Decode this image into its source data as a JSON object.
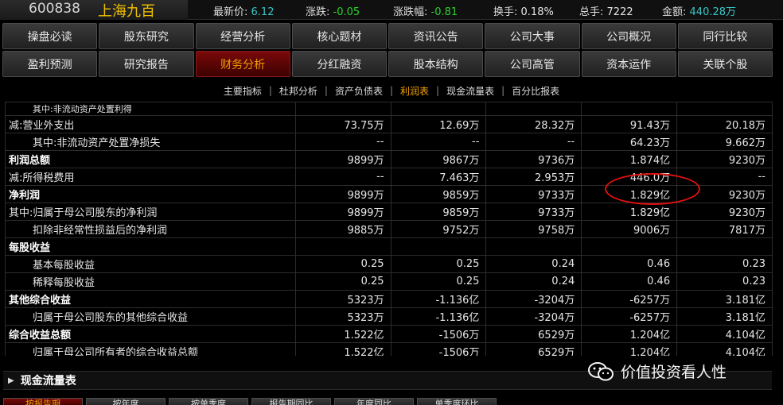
{
  "ticker": {
    "code": "600838",
    "name": "上海九百",
    "items": [
      {
        "label": "最新价:",
        "value": "6.12",
        "color": "cyan"
      },
      {
        "label": "涨跌:",
        "value": "-0.05",
        "color": "green"
      },
      {
        "label": "涨跌幅:",
        "value": "-0.81",
        "color": "green"
      },
      {
        "label": "换手:",
        "value": "0.18%",
        "color": "plain"
      },
      {
        "label": "总手:",
        "value": "7222",
        "color": "plain"
      },
      {
        "label": "金额:",
        "value": "440.28万",
        "color": "cyan"
      }
    ]
  },
  "nav": {
    "row1": [
      "操盘必读",
      "股东研究",
      "经营分析",
      "核心题材",
      "资讯公告",
      "公司大事",
      "公司概况",
      "同行比较"
    ],
    "row2": [
      "盈利预测",
      "研究报告",
      "财务分析",
      "分红融资",
      "股本结构",
      "公司高管",
      "资本运作",
      "关联个股"
    ],
    "active": "财务分析"
  },
  "subtabs": {
    "items": [
      "主要指标",
      "杜邦分析",
      "资产负债表",
      "利润表",
      "现金流量表",
      "百分比报表"
    ],
    "active": "利润表"
  },
  "table": {
    "partial_row_label": "其中:非流动资产处置利得",
    "rows": [
      {
        "label": "减:营业外支出",
        "style": "plain",
        "values": [
          "73.75万",
          "12.69万",
          "28.32万",
          "91.43万",
          "20.18万"
        ]
      },
      {
        "label": "其中:非流动资产处置净损失",
        "style": "indent",
        "values": [
          "--",
          "--",
          "--",
          "64.23万",
          "9.662万"
        ]
      },
      {
        "label": "利润总额",
        "style": "bold",
        "values": [
          "9899万",
          "9867万",
          "9736万",
          "1.874亿",
          "9230万"
        ]
      },
      {
        "label": "减:所得税费用",
        "style": "plain",
        "values": [
          "--",
          "7.463万",
          "2.953万",
          "446.0万",
          "--"
        ]
      },
      {
        "label": "净利润",
        "style": "bold",
        "values": [
          "9899万",
          "9859万",
          "9733万",
          "1.829亿",
          "9230万"
        ]
      },
      {
        "label": "其中:归属于母公司股东的净利润",
        "style": "plain",
        "values": [
          "9899万",
          "9859万",
          "9733万",
          "1.829亿",
          "9230万"
        ]
      },
      {
        "label": "扣除非经常性损益后的净利润",
        "style": "indent",
        "values": [
          "9885万",
          "9752万",
          "9758万",
          "9006万",
          "7817万"
        ]
      },
      {
        "label": "每股收益",
        "style": "bold",
        "values": [
          "",
          "",
          "",
          "",
          ""
        ]
      },
      {
        "label": "基本每股收益",
        "style": "indent",
        "values": [
          "0.25",
          "0.25",
          "0.24",
          "0.46",
          "0.23"
        ]
      },
      {
        "label": "稀释每股收益",
        "style": "indent",
        "values": [
          "0.25",
          "0.25",
          "0.24",
          "0.46",
          "0.23"
        ]
      },
      {
        "label": "其他综合收益",
        "style": "bold",
        "values": [
          "5323万",
          "-1.136亿",
          "-3204万",
          "-6257万",
          "3.181亿"
        ]
      },
      {
        "label": "归属于母公司股东的其他综合收益",
        "style": "indent",
        "values": [
          "5323万",
          "-1.136亿",
          "-3204万",
          "-6257万",
          "3.181亿"
        ]
      },
      {
        "label": "综合收益总额",
        "style": "bold",
        "values": [
          "1.522亿",
          "-1506万",
          "6529万",
          "1.204亿",
          "4.104亿"
        ]
      },
      {
        "label": "归属于母公司所有者的综合收益总额",
        "style": "indent",
        "values": [
          "1.522亿",
          "-1506万",
          "6529万",
          "1.204亿",
          "4.104亿"
        ]
      }
    ]
  },
  "cash_section": {
    "title": "现金流量表",
    "arrow": "▶"
  },
  "watermark": {
    "text": "价值投资看人性",
    "icon": "wechat-icon"
  },
  "bottom_tabs": [
    "按报告期",
    "按年度",
    "按单季度",
    "报告期同比",
    "年度同比",
    "单季度环比"
  ],
  "colors": {
    "active_bg": "#5a0505",
    "active_text": "#f0a000",
    "highlight_ring": "#e01010",
    "up_green": "#2ed12e"
  }
}
